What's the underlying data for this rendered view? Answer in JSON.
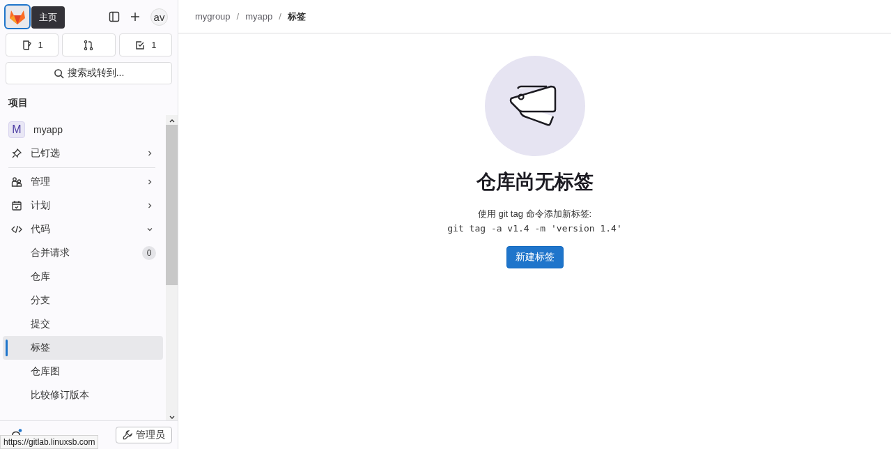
{
  "top_bar": {
    "tooltip": "主页",
    "avatar": "av"
  },
  "counters": [
    {
      "kind": "issues",
      "count": "1"
    },
    {
      "kind": "merge_requests"
    },
    {
      "kind": "todos",
      "count": "1"
    }
  ],
  "search": {
    "label": "搜索或转到..."
  },
  "sidebar": {
    "heading": "项目",
    "project": {
      "avatar": "M",
      "name": "myapp"
    },
    "items": [
      {
        "kind": "pinned",
        "label": "已钉选",
        "expanded": false
      },
      {
        "kind": "manage",
        "label": "管理",
        "expanded": false
      },
      {
        "kind": "plan",
        "label": "计划",
        "expanded": false
      },
      {
        "kind": "code",
        "label": "代码",
        "expanded": true,
        "children": [
          {
            "label": "合并请求",
            "badge": "0",
            "selected": false
          },
          {
            "label": "仓库",
            "selected": false
          },
          {
            "label": "分支",
            "selected": false
          },
          {
            "label": "提交",
            "selected": false
          },
          {
            "label": "标签",
            "selected": true
          },
          {
            "label": "仓库图",
            "selected": false
          },
          {
            "label": "比较修订版本",
            "selected": false
          }
        ]
      }
    ],
    "admin_button": "管理员"
  },
  "status_url": "https://gitlab.linuxsb.com",
  "breadcrumbs": [
    {
      "label": "mygroup",
      "current": false
    },
    {
      "kind": "separator",
      "label": "/"
    },
    {
      "label": "myapp",
      "current": false
    },
    {
      "kind": "separator",
      "label": "/"
    },
    {
      "label": "标签",
      "current": true
    }
  ],
  "empty_state": {
    "title": "仓库尚无标签",
    "description": "使用 git tag 命令添加新标签:",
    "command": "git tag -a v1.4 -m 'version 1.4'",
    "button": "新建标签"
  }
}
